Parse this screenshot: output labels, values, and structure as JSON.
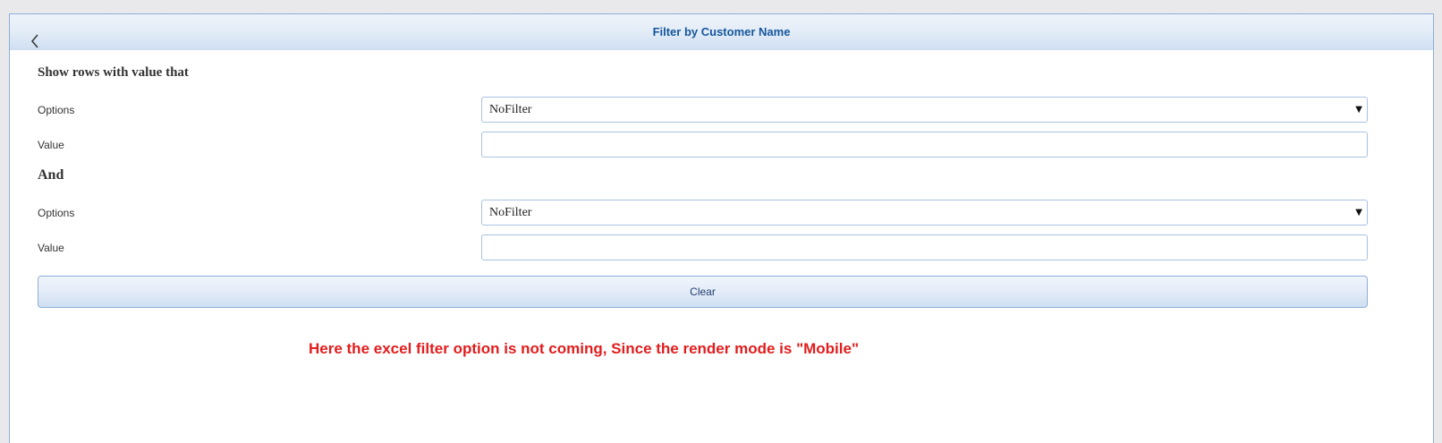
{
  "header": {
    "title": "Filter by Customer Name",
    "back_icon": "chevron-left-icon"
  },
  "filter": {
    "section_heading": "Show rows with value that",
    "and_heading": "And",
    "first": {
      "options_label": "Options",
      "options_value": "NoFilter",
      "value_label": "Value",
      "value": ""
    },
    "second": {
      "options_label": "Options",
      "options_value": "NoFilter",
      "value_label": "Value",
      "value": ""
    },
    "clear_label": "Clear"
  },
  "annotation": {
    "text": "Here the excel filter option is not coming, Since the render mode is \"Mobile\"",
    "color": "#e11d1d"
  },
  "colors": {
    "accent": "#15569b",
    "border": "#8eaed6"
  }
}
